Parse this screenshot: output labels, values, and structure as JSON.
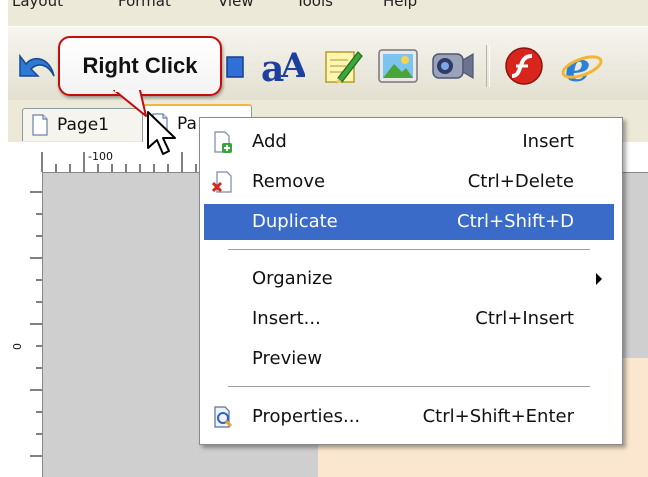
{
  "menubar": {
    "items": [
      "Layout",
      "Format",
      "View",
      "Tools",
      "Help"
    ]
  },
  "toolbar": {
    "buttons": [
      "undo-icon",
      "shape-icon",
      "text-art-icon",
      "edit-note-icon",
      "picture-icon",
      "camera-icon",
      "flash-icon",
      "internet-explorer-icon"
    ]
  },
  "callout": {
    "text": "Right Click"
  },
  "tabs": [
    {
      "label": "Page1"
    },
    {
      "label": "Pa"
    }
  ],
  "ruler": {
    "h_label": "-100",
    "v_label": "0"
  },
  "context_menu": {
    "items": [
      {
        "label": "Add",
        "shortcut": "Insert",
        "icon": "add-page-icon"
      },
      {
        "label": "Remove",
        "shortcut": "Ctrl+Delete",
        "icon": "remove-page-icon"
      },
      {
        "label": "Duplicate",
        "shortcut": "Ctrl+Shift+D",
        "highlighted": true
      },
      {
        "label": "Organize",
        "submenu": true
      },
      {
        "label": "Insert...",
        "shortcut": "Ctrl+Insert"
      },
      {
        "label": "Preview"
      },
      {
        "label": "Properties...",
        "shortcut": "Ctrl+Shift+Enter",
        "icon": "properties-icon"
      }
    ]
  },
  "colors": {
    "highlight": "#3a6bc8",
    "callout_border": "#c30c0c",
    "workspace": "#cfcfcf"
  }
}
